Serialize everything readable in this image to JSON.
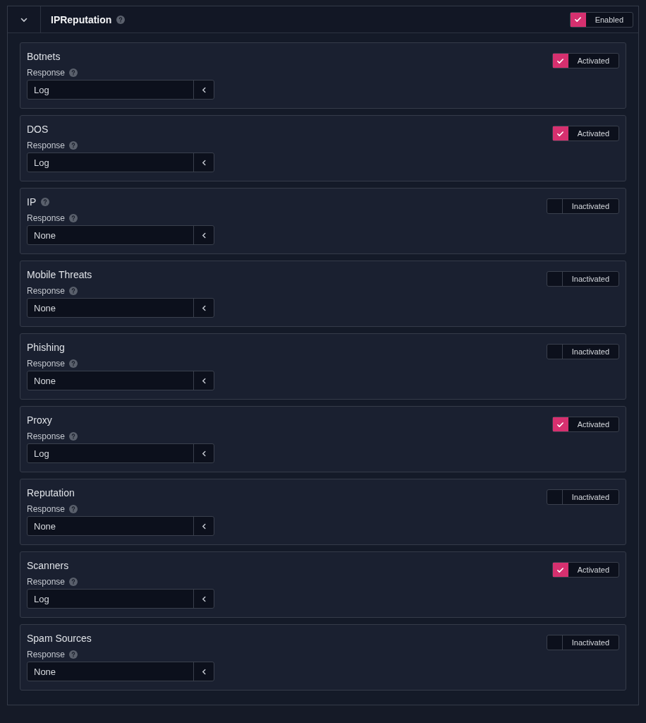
{
  "section": {
    "title": "IPReputation",
    "expanded": true,
    "toggle": {
      "label": "Enabled",
      "checked": true
    }
  },
  "categories": [
    {
      "name": "Botnets",
      "help": false,
      "response_label": "Response",
      "response": "Log",
      "toggle": {
        "label": "Activated",
        "checked": true
      }
    },
    {
      "name": "DOS",
      "help": false,
      "response_label": "Response",
      "response": "Log",
      "toggle": {
        "label": "Activated",
        "checked": true
      }
    },
    {
      "name": "IP",
      "help": true,
      "response_label": "Response",
      "response": "None",
      "toggle": {
        "label": "Inactivated",
        "checked": false
      }
    },
    {
      "name": "Mobile Threats",
      "help": false,
      "response_label": "Response",
      "response": "None",
      "toggle": {
        "label": "Inactivated",
        "checked": false
      }
    },
    {
      "name": "Phishing",
      "help": false,
      "response_label": "Response",
      "response": "None",
      "toggle": {
        "label": "Inactivated",
        "checked": false
      }
    },
    {
      "name": "Proxy",
      "help": false,
      "response_label": "Response",
      "response": "Log",
      "toggle": {
        "label": "Activated",
        "checked": true
      }
    },
    {
      "name": "Reputation",
      "help": false,
      "response_label": "Response",
      "response": "None",
      "toggle": {
        "label": "Inactivated",
        "checked": false
      }
    },
    {
      "name": "Scanners",
      "help": false,
      "response_label": "Response",
      "response": "Log",
      "toggle": {
        "label": "Activated",
        "checked": true
      }
    },
    {
      "name": "Spam Sources",
      "help": false,
      "response_label": "Response",
      "response": "None",
      "toggle": {
        "label": "Inactivated",
        "checked": false
      }
    }
  ]
}
